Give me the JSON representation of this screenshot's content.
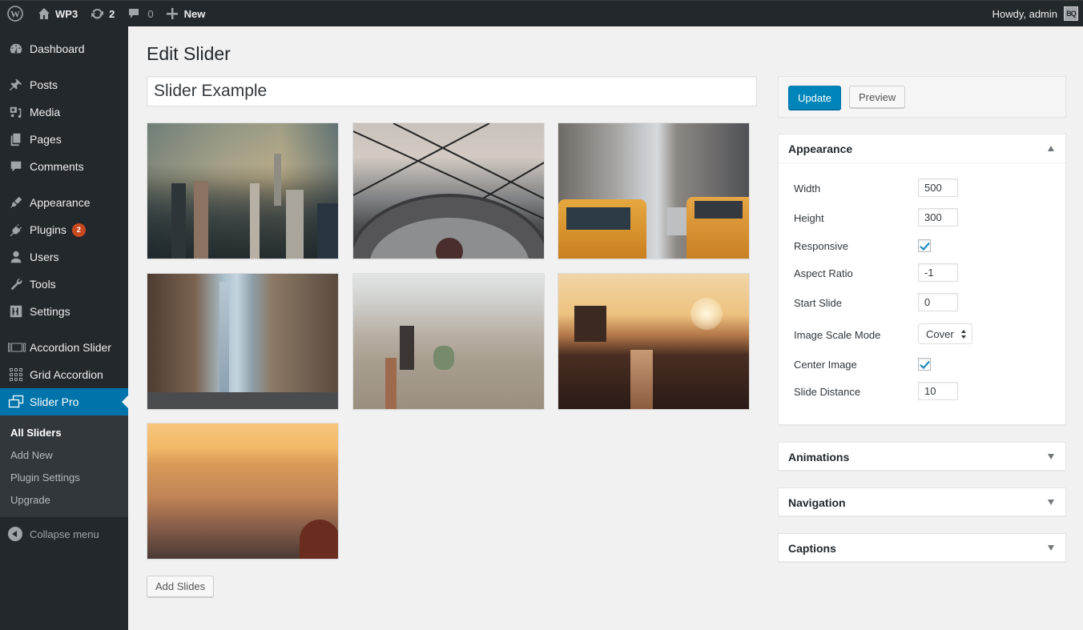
{
  "adminbar": {
    "site_name": "WP3",
    "updates_count": "2",
    "comments_count": "0",
    "new_label": "New",
    "greeting": "Howdy, admin",
    "avatar_text": "BQ"
  },
  "sidebar": {
    "items": [
      {
        "label": "Dashboard",
        "icon": "dashboard-icon"
      },
      {
        "label": "Posts",
        "icon": "pin-icon"
      },
      {
        "label": "Media",
        "icon": "media-icon"
      },
      {
        "label": "Pages",
        "icon": "pages-icon"
      },
      {
        "label": "Comments",
        "icon": "comment-icon"
      },
      {
        "label": "Appearance",
        "icon": "paintbrush-icon"
      },
      {
        "label": "Plugins",
        "icon": "plugin-icon",
        "badge": "2"
      },
      {
        "label": "Users",
        "icon": "user-icon"
      },
      {
        "label": "Tools",
        "icon": "wrench-icon"
      },
      {
        "label": "Settings",
        "icon": "settings-icon"
      },
      {
        "label": "Accordion Slider",
        "icon": "accordion-slider-icon"
      },
      {
        "label": "Grid Accordion",
        "icon": "grid-icon"
      },
      {
        "label": "Slider Pro",
        "icon": "slider-pro-icon",
        "active": true
      }
    ],
    "submenu": [
      {
        "label": "All Sliders",
        "current": true
      },
      {
        "label": "Add New"
      },
      {
        "label": "Plugin Settings"
      },
      {
        "label": "Upgrade"
      }
    ],
    "collapse_label": "Collapse menu"
  },
  "main": {
    "title": "Edit Slider",
    "slider_name": "Slider Example",
    "slides": [
      {
        "alt": "Manhattan skyline with Empire State Building"
      },
      {
        "alt": "Observation deck binocular view through fence"
      },
      {
        "alt": "Yellow taxis on city street"
      },
      {
        "alt": "Street view of One World Trade Center"
      },
      {
        "alt": "Hazy aerial view of city"
      },
      {
        "alt": "Sunset over elevated train tracks"
      },
      {
        "alt": "Golden hour over hillside city neighborhood"
      }
    ],
    "add_slides_label": "Add Slides"
  },
  "panel": {
    "update_label": "Update",
    "preview_label": "Preview",
    "appearance": {
      "title": "Appearance",
      "expanded": true,
      "fields": {
        "width": {
          "label": "Width",
          "value": "500"
        },
        "height": {
          "label": "Height",
          "value": "300"
        },
        "responsive": {
          "label": "Responsive",
          "checked": true
        },
        "aspect_ratio": {
          "label": "Aspect Ratio",
          "value": "-1"
        },
        "start_slide": {
          "label": "Start Slide",
          "value": "0"
        },
        "image_scale_mode": {
          "label": "Image Scale Mode",
          "value": "Cover"
        },
        "center_image": {
          "label": "Center Image",
          "checked": true
        },
        "slide_distance": {
          "label": "Slide Distance",
          "value": "10"
        }
      }
    },
    "sections": [
      {
        "title": "Animations",
        "expanded": false
      },
      {
        "title": "Navigation",
        "expanded": false
      },
      {
        "title": "Captions",
        "expanded": false
      }
    ]
  },
  "colors": {
    "accent": "#0073aa",
    "primary_button": "#0085ba",
    "adminbar_bg": "#23282d",
    "badge": "#ca4a1f",
    "page_bg": "#f1f1f1"
  }
}
